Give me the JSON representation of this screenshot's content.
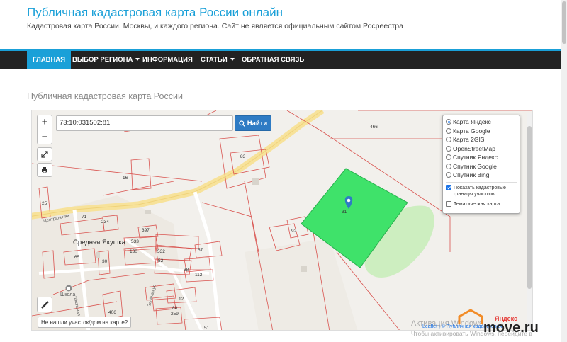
{
  "header": {
    "title": "Публичная кадастровая карта России онлайн",
    "tagline": "Кадастровая карта России, Москвы, и каждого региона. Сайт не является официальным сайтом Росреестра"
  },
  "nav": {
    "items": [
      {
        "label": "ГЛАВНАЯ",
        "active": true,
        "dropdown": false
      },
      {
        "label": "ВЫБОР РЕГИОНА",
        "active": false,
        "dropdown": true
      },
      {
        "label": "ИНФОРМАЦИЯ",
        "active": false,
        "dropdown": false
      },
      {
        "label": "СТАТЬИ",
        "active": false,
        "dropdown": true
      },
      {
        "label": "ОБРАТНАЯ СВЯЗЬ",
        "active": false,
        "dropdown": false
      }
    ]
  },
  "page": {
    "heading": "Публичная кадастровая карта России"
  },
  "map": {
    "search_value": "73:10:031502:81",
    "search_button": "Найти",
    "zoom_in": "+",
    "zoom_out": "−",
    "not_found": "Не нашли участок/дом на карте?",
    "village": "Средняя Якушка",
    "school": "Школа",
    "street_1": "Центральная",
    "street_2": "Школьная ул",
    "street_3": "Зелёная ул",
    "parcel_labels": {
      "p466": "466",
      "p83": "83",
      "p92": "92",
      "p71": "71",
      "p234": "234",
      "p397": "397",
      "p533": "533",
      "p532": "532",
      "p130": "130",
      "p52": "52",
      "p65": "65",
      "p57": "57",
      "p38": "38",
      "p112": "112",
      "p406": "406",
      "p12": "12",
      "p80": "80",
      "p259": "259",
      "p51": "51",
      "p25": "25",
      "p16": "16",
      "p30": "30",
      "p31": "31"
    },
    "layers": {
      "base": [
        {
          "label": "Карта Яндекс",
          "selected": true
        },
        {
          "label": "Карта Google",
          "selected": false
        },
        {
          "label": "Карта 2GIS",
          "selected": false
        },
        {
          "label": "OpenStreetMap",
          "selected": false
        },
        {
          "label": "Спутник Яндекс",
          "selected": false
        },
        {
          "label": "Спутник Google",
          "selected": false
        },
        {
          "label": "Спутник Bing",
          "selected": false
        }
      ],
      "show_borders": "Показать кадастровые границы участков",
      "show_borders_checked": true,
      "thematic": "Тематическая карта",
      "thematic_checked": false
    },
    "attribution": "Leaflet | © Публичная кадастровая",
    "yandex": "Яндекс",
    "activation_title": "Активация Windows",
    "activation_sub": "Чтобы активировать Windows, перейдите в",
    "watermark": "move.ru"
  },
  "colors": {
    "accent": "#1aa0d8",
    "nav_bg": "#222222",
    "selected_parcel": "#3fe26a",
    "parcel_line": "#d9534f",
    "search_btn": "#2e7bc4"
  }
}
